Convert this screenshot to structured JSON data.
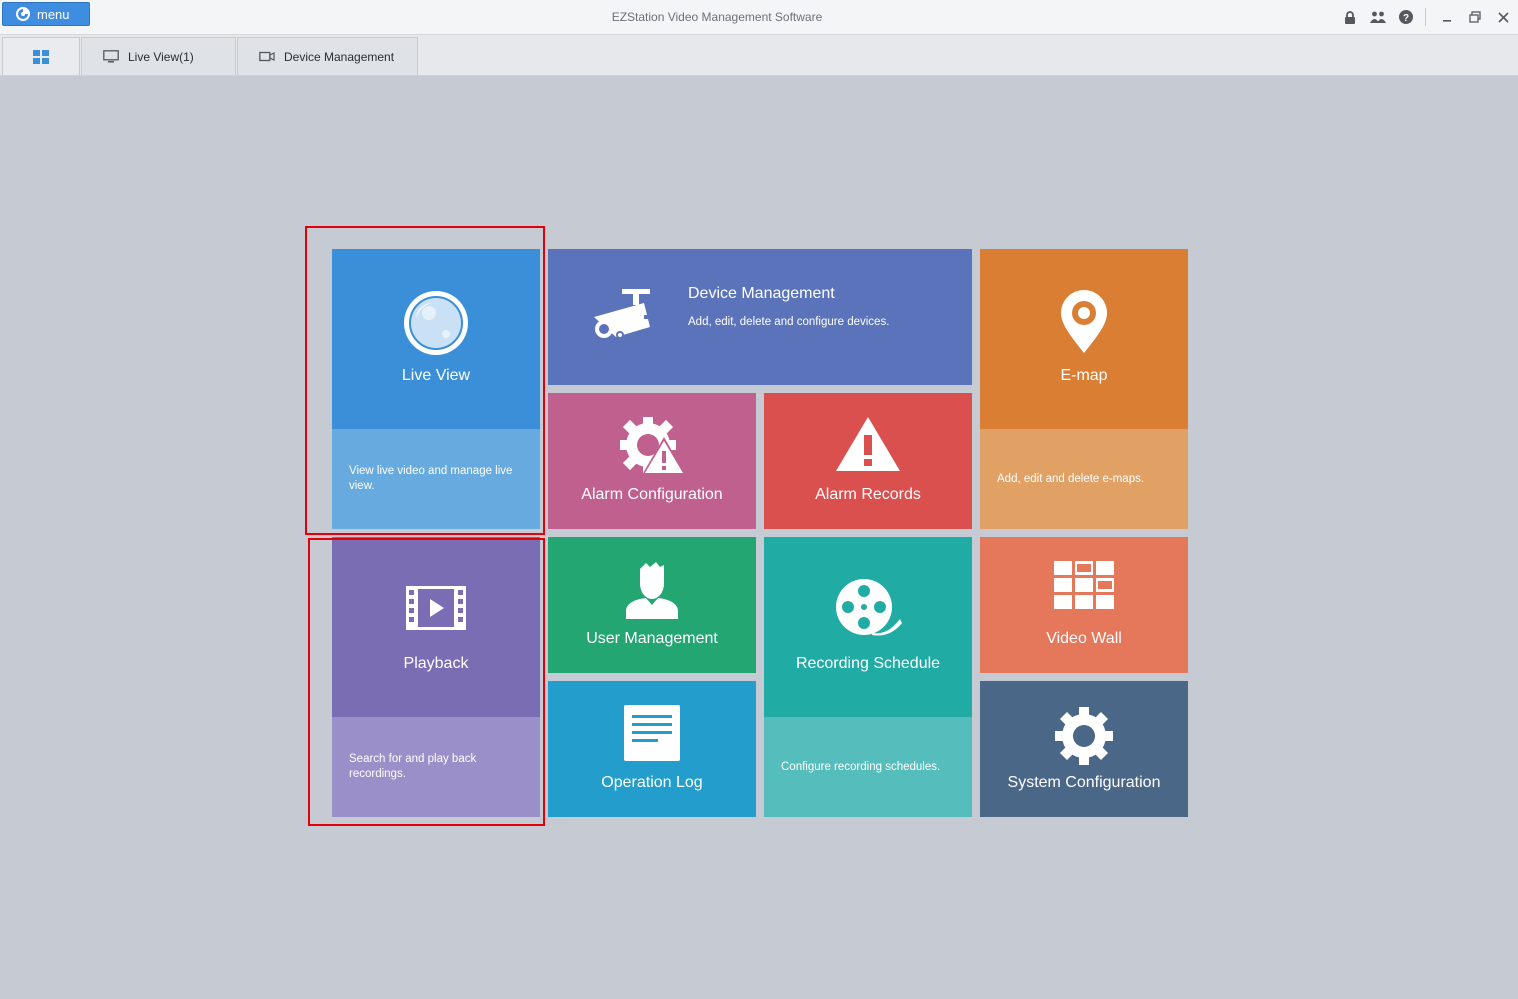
{
  "app": {
    "title": "EZStation Video Management Software",
    "menu_label": "menu"
  },
  "tabs": [
    {
      "label": ""
    },
    {
      "label": "Live View(1)"
    },
    {
      "label": "Device Management"
    }
  ],
  "tiles": {
    "live_view": {
      "title": "Live View",
      "desc": "View live video and manage live view.",
      "color": "#3a8fd8",
      "desc_color": "#67aadf"
    },
    "device_management": {
      "title": "Device Management",
      "desc": "Add, edit, delete and configure devices.",
      "color": "#5a73bb"
    },
    "emap": {
      "title": "E-map",
      "desc": "Add, edit and delete e-maps.",
      "color": "#d97e33",
      "desc_color": "#e1a064"
    },
    "alarm_configuration": {
      "title": "Alarm Configuration",
      "color": "#c0608f"
    },
    "alarm_records": {
      "title": "Alarm Records",
      "color": "#d9504f"
    },
    "playback": {
      "title": "Playback",
      "desc": "Search for and play back recordings.",
      "color": "#7a6db3",
      "desc_color": "#9a8fc8"
    },
    "user_management": {
      "title": "User Management",
      "color": "#24a673"
    },
    "recording_schedule": {
      "title": "Recording Schedule",
      "desc": "Configure recording schedules.",
      "color": "#20aca4",
      "desc_color": "#55bebc"
    },
    "video_wall": {
      "title": "Video Wall",
      "color": "#e5775b"
    },
    "operation_log": {
      "title": "Operation Log",
      "color": "#239dcb"
    },
    "system_configuration": {
      "title": "System Configuration",
      "color": "#4a6788"
    }
  },
  "highlight_color": "#e3000b"
}
